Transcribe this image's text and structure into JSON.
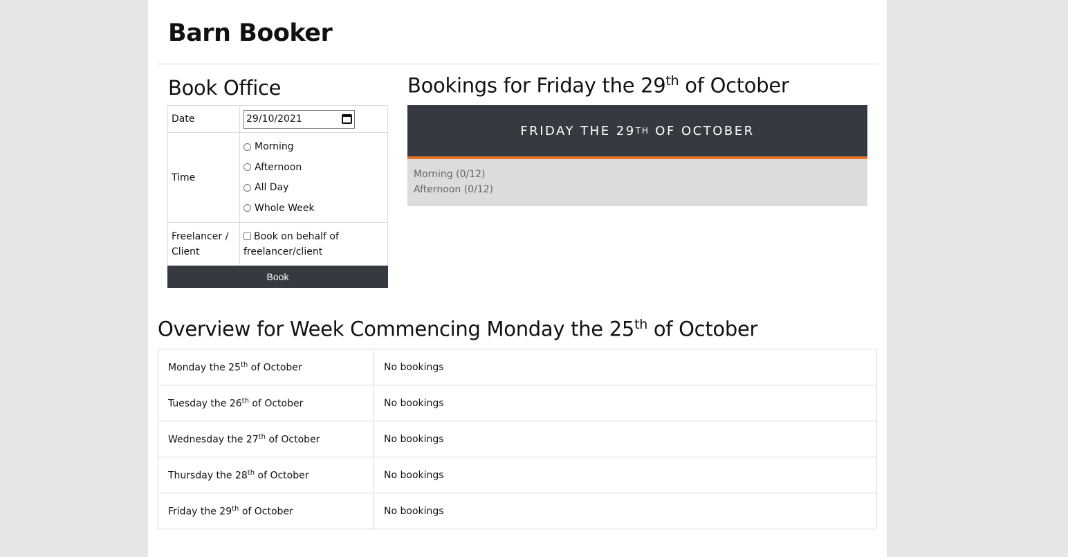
{
  "app": {
    "title": "Barn Booker"
  },
  "book_form": {
    "heading": "Book Office",
    "date_label": "Date",
    "date_value": "29/10/2021",
    "time_label": "Time",
    "time_options": [
      "Morning",
      "Afternoon",
      "All Day",
      "Whole Week"
    ],
    "freelancer_label": "Freelancer / Client",
    "freelancer_checkbox_label": "Book on behalf of freelancer/client",
    "book_button": "Book"
  },
  "bookings": {
    "heading_prefix": "Bookings for Friday the 29",
    "heading_sup": "th",
    "heading_suffix": " of October",
    "day_header_prefix": "FRIDAY THE 29",
    "day_header_sup": "TH",
    "day_header_suffix": " OF OCTOBER",
    "slots": [
      "Morning (0/12)",
      "Afternoon (0/12)"
    ],
    "accent_color": "#e8732a"
  },
  "overview": {
    "heading_prefix": "Overview for Week Commencing Monday the 25",
    "heading_sup": "th",
    "heading_suffix": " of October",
    "rows": [
      {
        "day_prefix": "Monday the 25",
        "sup": "th",
        "day_suffix": " of October",
        "status": "No bookings"
      },
      {
        "day_prefix": "Tuesday the 26",
        "sup": "th",
        "day_suffix": " of October",
        "status": "No bookings"
      },
      {
        "day_prefix": "Wednesday the 27",
        "sup": "th",
        "day_suffix": " of October",
        "status": "No bookings"
      },
      {
        "day_prefix": "Thursday the 28",
        "sup": "th",
        "day_suffix": " of October",
        "status": "No bookings"
      },
      {
        "day_prefix": "Friday the 29",
        "sup": "th",
        "day_suffix": " of October",
        "status": "No bookings"
      }
    ]
  }
}
